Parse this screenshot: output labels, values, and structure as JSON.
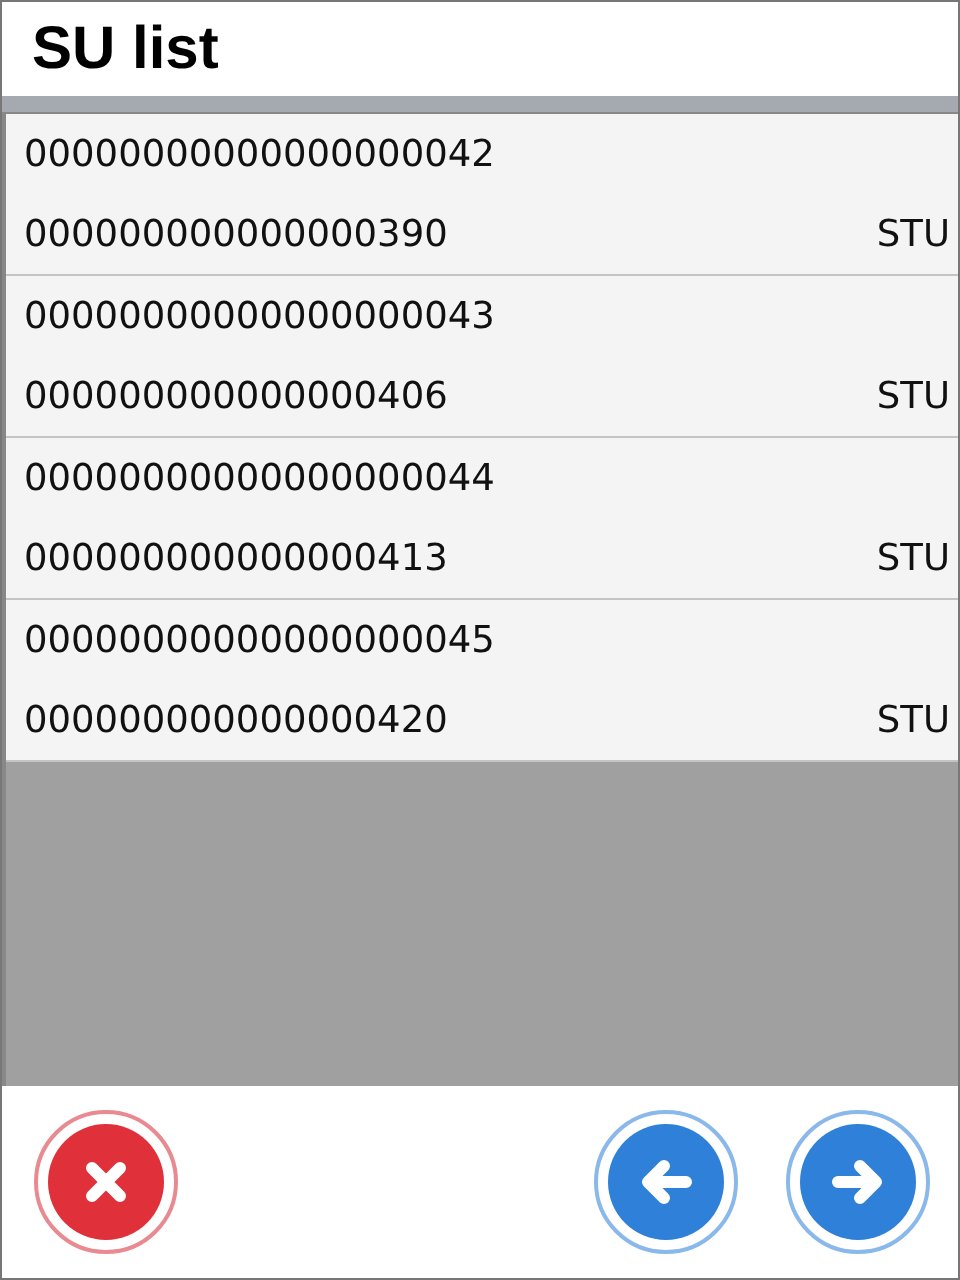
{
  "window": {
    "title": "SU list"
  },
  "rows": [
    {
      "su": "00000000000000000042",
      "number": "000000000000000390",
      "type": "STU"
    },
    {
      "su": "00000000000000000043",
      "number": "000000000000000406",
      "type": "STU"
    },
    {
      "su": "00000000000000000044",
      "number": "000000000000000413",
      "type": "STU"
    },
    {
      "su": "00000000000000000045",
      "number": "000000000000000420",
      "type": "STU"
    }
  ],
  "buttons": [
    {
      "kind": "cancel"
    },
    {
      "kind": "back"
    },
    {
      "kind": "next"
    }
  ]
}
